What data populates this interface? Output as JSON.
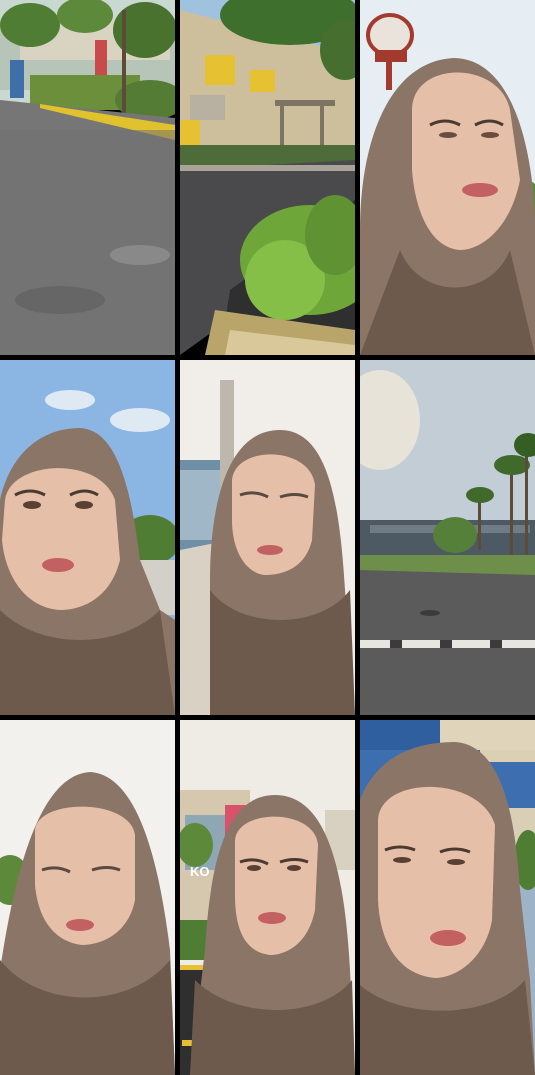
{
  "frames": [
    {
      "scene": "asphalt-road-with-curb-and-trees"
    },
    {
      "scene": "building-facade-with-plant-bed"
    },
    {
      "scene": "woman-in-hijab-under-sign"
    },
    {
      "scene": "woman-in-hijab-blue-sky"
    },
    {
      "scene": "woman-in-hijab-eyes-closed-bright-sky"
    },
    {
      "scene": "parking-lot-with-palm-trees"
    },
    {
      "scene": "woman-in-hijab-eyes-closed-white-sky"
    },
    {
      "scene": "woman-in-hijab-near-mall-entrance"
    },
    {
      "scene": "woman-in-hijab-glass-building"
    }
  ],
  "storefront_text": "KO",
  "colors": {
    "hijab": "#8b7566",
    "hijab_shadow": "#6e5a4d",
    "skin": "#e6bfa8",
    "skin_shadow": "#d1a58c",
    "sky_blue": "#8bb6e3",
    "sky_white": "#f1eee9",
    "asphalt": "#6a6a6a",
    "foliage": "#5d8a3a",
    "divider": "#000000"
  }
}
